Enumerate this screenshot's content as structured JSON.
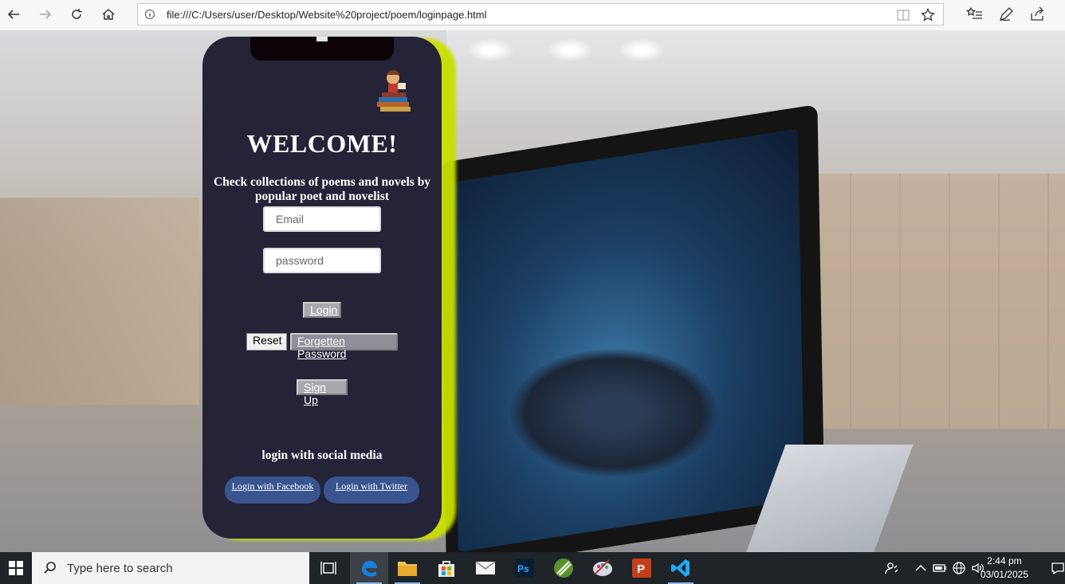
{
  "browser": {
    "url": "file:///C:/Users/user/Desktop/Website%20project/poem/loginpage.html"
  },
  "login": {
    "title": "WELCOME!",
    "tagline": "Check collections of poems and novels by popular poet and novelist",
    "email_placeholder": "Email",
    "password_placeholder": "password",
    "login_label": "Login",
    "reset_label": "Reset",
    "forgot_label": "Forgetten Password",
    "signup_label": "Sign Up",
    "social_title": "login with social media",
    "facebook_label": "Login with Facebook",
    "twitter_label": "Login with Twitter"
  },
  "taskbar": {
    "search_placeholder": "Type here to search",
    "time": "2:44 pm",
    "date": "03/01/2025"
  },
  "colors": {
    "card_bg": "#252338",
    "card_glow": "#c8e000",
    "social_button": "#3a5490",
    "taskbar_bg": "#1f2428"
  }
}
